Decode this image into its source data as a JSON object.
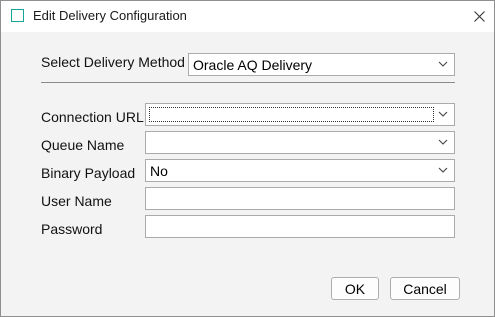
{
  "window": {
    "title": "Edit Delivery Configuration"
  },
  "delivery_method": {
    "label": "Select Delivery Method",
    "value": "Oracle AQ Delivery"
  },
  "fields": {
    "connection_url": {
      "label": "Connection URL",
      "value": ""
    },
    "queue_name": {
      "label": "Queue Name",
      "value": ""
    },
    "binary_payload": {
      "label": "Binary Payload",
      "value": "No"
    },
    "user_name": {
      "label": "User Name",
      "value": ""
    },
    "password": {
      "label": "Password",
      "value": ""
    }
  },
  "buttons": {
    "ok": "OK",
    "cancel": "Cancel"
  },
  "colors": {
    "app_icon_accent": "#15a39a",
    "dialog_background": "#f3f3f3"
  },
  "icons": {
    "app": "app-window-icon",
    "close": "close-icon",
    "dropdown": "chevron-down-icon"
  }
}
